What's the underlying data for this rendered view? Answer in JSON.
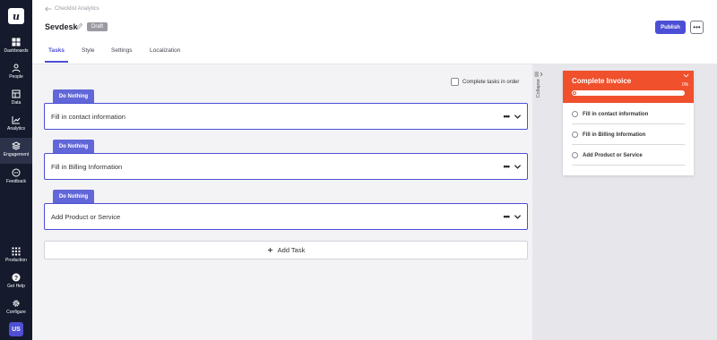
{
  "nav": {
    "logo": "u",
    "items": [
      {
        "label": "Dashboards",
        "icon": "dashboard-icon"
      },
      {
        "label": "People",
        "icon": "people-icon"
      },
      {
        "label": "Data",
        "icon": "data-icon"
      },
      {
        "label": "Analytics",
        "icon": "analytics-icon"
      },
      {
        "label": "Engagement",
        "icon": "engagement-icon",
        "active": true
      },
      {
        "label": "Feedback",
        "icon": "feedback-icon"
      }
    ],
    "bottom_items": [
      {
        "label": "Production",
        "icon": "grid-icon"
      },
      {
        "label": "Get Help",
        "icon": "help-icon"
      },
      {
        "label": "Configure",
        "icon": "gear-icon"
      }
    ],
    "avatar": "US"
  },
  "header": {
    "back_link": "Checklist Analytics",
    "title": "Sevdesk",
    "status": "Draft",
    "publish_label": "Publish",
    "more_label": "•••",
    "tabs": [
      "Tasks",
      "Style",
      "Settings",
      "Localization"
    ],
    "active_tab": "Tasks"
  },
  "tasks_panel": {
    "complete_in_order_label": "Complete tasks in order",
    "complete_in_order_checked": false,
    "action_label": "Do Nothing",
    "tasks": [
      {
        "name": "Fill in contact information",
        "action": "Do Nothing"
      },
      {
        "name": "Fill in Billing Information",
        "action": "Do Nothing"
      },
      {
        "name": "Add Product or Service",
        "action": "Do Nothing"
      }
    ],
    "task_menu_label": "•••",
    "add_task_label": "Add Task"
  },
  "preview": {
    "collapse_label": "Collapse",
    "title": "Complete Invoice",
    "progress_percent": 0,
    "progress_label": "0%",
    "items": [
      "Fill in contact information",
      "Fill in Billing Information",
      "Add Product or Service"
    ]
  },
  "colors": {
    "accent": "#4c4fd6",
    "action_tag": "#6166d8",
    "preview_header": "#f0502c",
    "sidebar": "#151a2d"
  }
}
